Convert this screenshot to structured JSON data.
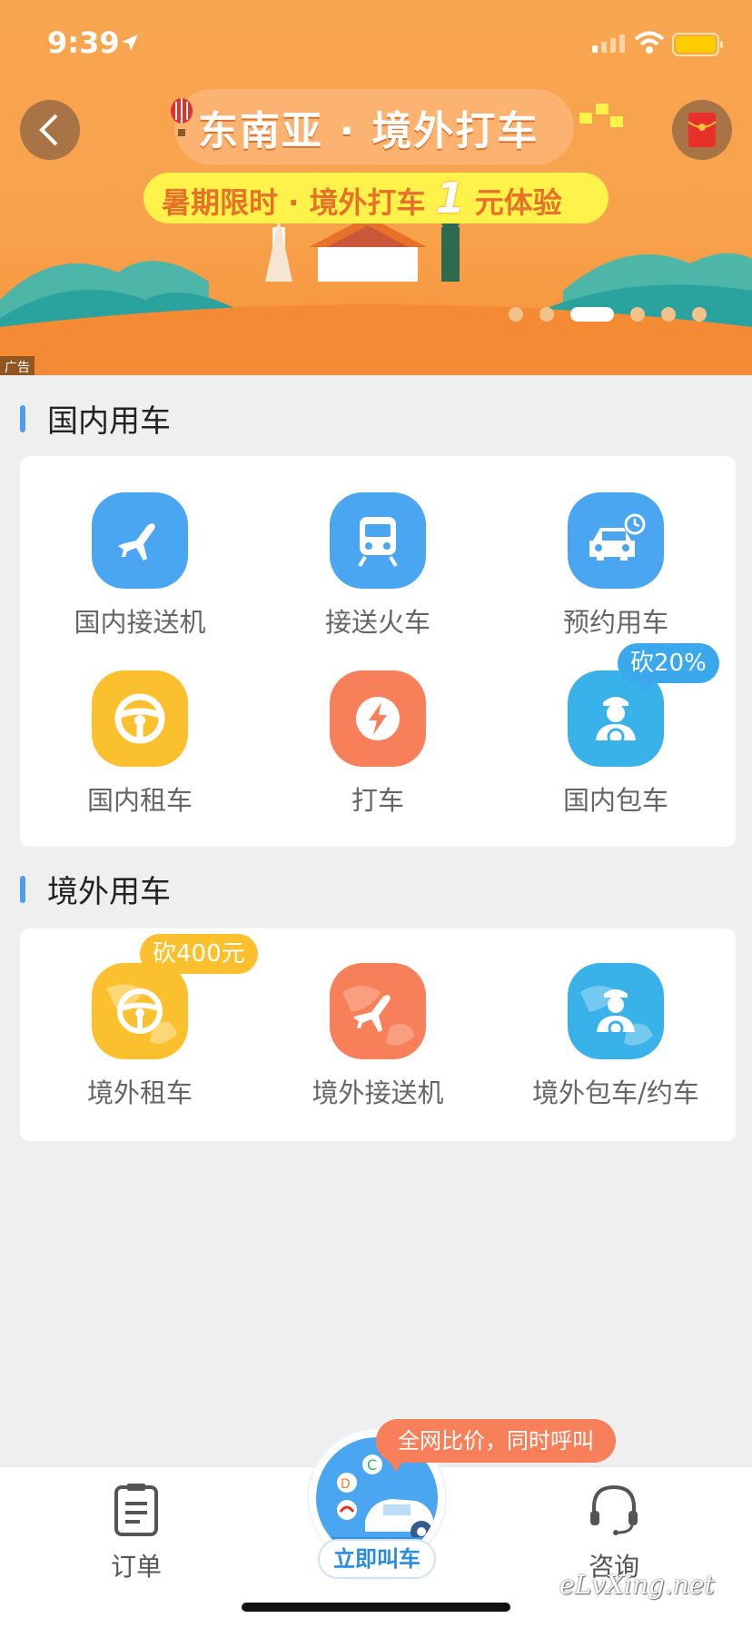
{
  "status_bar": {
    "time": "9:39"
  },
  "banner": {
    "title": "东南亚 · 境外打车",
    "subtitle_pre": "暑期限时 · 境外打车",
    "subtitle_num": "1",
    "subtitle_post": "元体验",
    "ad_tag": "广告",
    "carousel": {
      "count": 6,
      "active_index": 2
    }
  },
  "domestic": {
    "section_title": "国内用车",
    "items": [
      {
        "label": "国内接送机",
        "icon": "airplane-icon"
      },
      {
        "label": "接送火车",
        "icon": "train-icon"
      },
      {
        "label": "预约用车",
        "icon": "scheduled-car-icon"
      },
      {
        "label": "国内租车",
        "icon": "steering-wheel-icon"
      },
      {
        "label": "打车",
        "icon": "lightning-icon"
      },
      {
        "label": "国内包车",
        "icon": "chauffeur-icon",
        "badge": "砍20%"
      }
    ]
  },
  "overseas": {
    "section_title": "境外用车",
    "items": [
      {
        "label": "境外租车",
        "icon": "globe-steering-wheel-icon",
        "badge": "砍400元"
      },
      {
        "label": "境外接送机",
        "icon": "globe-airplane-icon"
      },
      {
        "label": "境外包车/约车",
        "icon": "globe-chauffeur-icon"
      }
    ]
  },
  "tabbar": {
    "orders_label": "订单",
    "call_label": "立即叫车",
    "consult_label": "咨询",
    "compare_tip": "全网比价，同时呼叫"
  },
  "watermark": "eLvXing.net",
  "colors": {
    "banner_orange": "#f8a24c",
    "accent_blue": "#4aa6f1",
    "accent_yellow": "#fbc02d",
    "accent_orange": "#f7805a",
    "accent_light_blue": "#39b2ea"
  }
}
